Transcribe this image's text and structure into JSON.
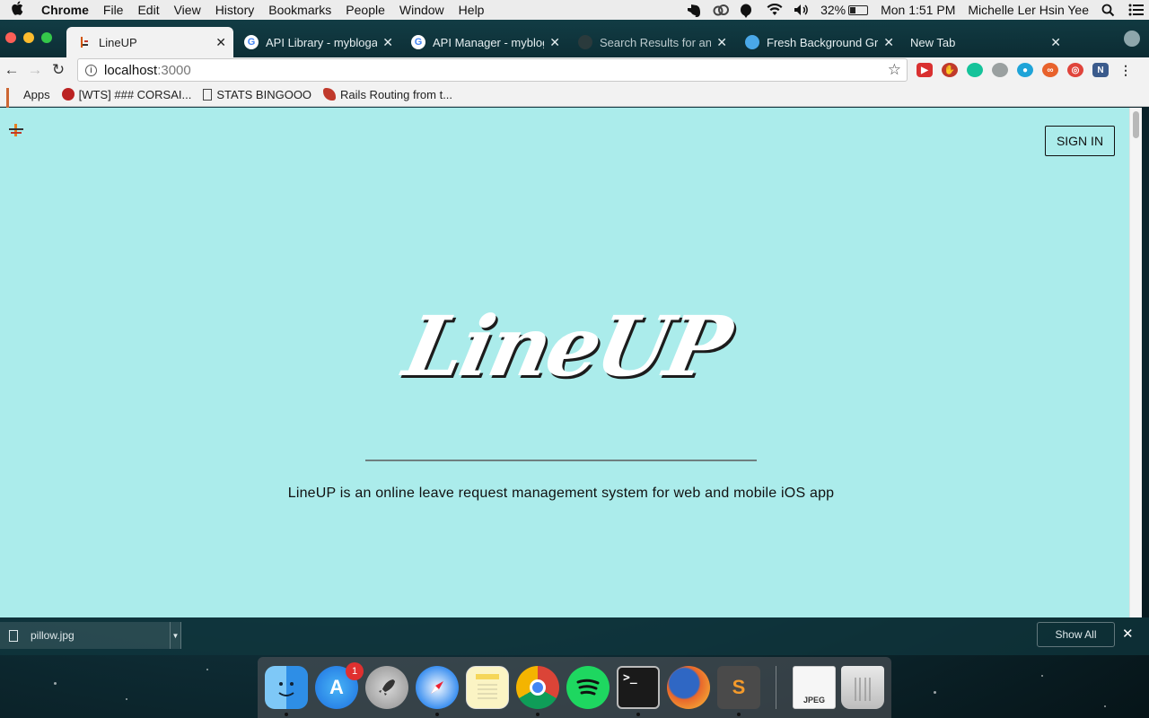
{
  "menubar": {
    "app_name": "Chrome",
    "items": [
      "File",
      "Edit",
      "View",
      "History",
      "Bookmarks",
      "People",
      "Window",
      "Help"
    ],
    "battery": "32%",
    "clock": "Mon 1:51 PM",
    "user": "Michelle  Ler Hsin Yee"
  },
  "tabs": [
    {
      "title": "LineUP",
      "active": true
    },
    {
      "title": "API Library - myblogapp",
      "active": false
    },
    {
      "title": "API Manager - myblogapp",
      "active": false
    },
    {
      "title": "Search Results for anim",
      "active": false
    },
    {
      "title": "Fresh Background Grad",
      "active": false
    },
    {
      "title": "New Tab",
      "active": false
    }
  ],
  "address_bar": {
    "host": "localhost",
    "port": ":3000"
  },
  "bookmarks": [
    {
      "label": "Apps"
    },
    {
      "label": "[WTS] ### CORSAI..."
    },
    {
      "label": "STATS BINGOOO"
    },
    {
      "label": "Rails Routing from t..."
    }
  ],
  "page": {
    "signin_label": "SIGN IN",
    "logo_text": "LineUP",
    "tagline": "LineUP is an online leave request management system for web and mobile iOS app",
    "background_color": "#abeceb"
  },
  "download_shelf": {
    "file_name": "pillow.jpg",
    "show_all_label": "Show All"
  },
  "dock": {
    "apps": [
      "finder",
      "app-store",
      "launchpad",
      "safari",
      "notes",
      "chrome",
      "spotify",
      "terminal",
      "firefox",
      "sublime-text",
      "preview-jpeg",
      "trash"
    ],
    "app_store_badge": "1",
    "jpeg_label": "JPEG"
  }
}
